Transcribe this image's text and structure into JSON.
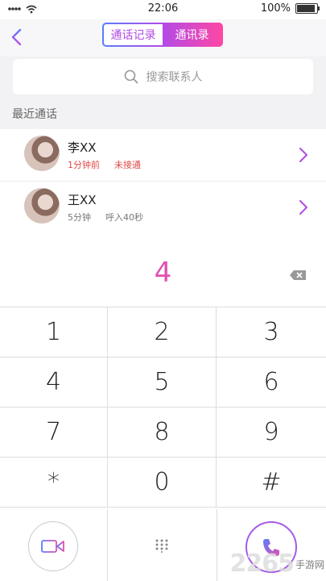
{
  "status_bar": {
    "time": "22:06",
    "battery": "100%",
    "battery_level": 1.0
  },
  "header": {
    "tab_call_log": "通话记录",
    "tab_contacts": "通讯录"
  },
  "search": {
    "placeholder": "搜索联系人"
  },
  "section_title": "最近通话",
  "calls": [
    {
      "name": "李XX",
      "time": "1分钟前",
      "status": "未接通"
    },
    {
      "name": "王XX",
      "time": "5分钟",
      "status": "呼入40秒"
    }
  ],
  "dialer": {
    "entered": "4",
    "keys": [
      "1",
      "2",
      "3",
      "4",
      "5",
      "6",
      "7",
      "8",
      "9",
      "*",
      "0",
      "#"
    ]
  },
  "watermark": {
    "number": "2265",
    "text": "手游网"
  },
  "colors": {
    "accent_pink": "#e14fb0",
    "accent_purple": "#b24be6",
    "missed_red": "#e04848"
  }
}
